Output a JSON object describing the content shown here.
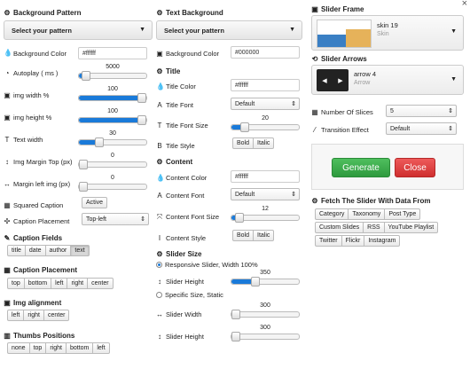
{
  "col1": {
    "bg_pattern": {
      "title": "Background Pattern",
      "select": "Select your pattern"
    },
    "bg_color": {
      "label": "Background Color",
      "value": "#ffffff"
    },
    "autoplay": {
      "label": "Autoplay ( ms )",
      "value": "5000",
      "pct": 0.1
    },
    "img_width": {
      "label": "img width %",
      "value": "100",
      "pct": 1.0
    },
    "img_height": {
      "label": "img height %",
      "value": "100",
      "pct": 1.0
    },
    "text_width": {
      "label": "Text width",
      "value": "30",
      "pct": 0.3
    },
    "img_margin_top": {
      "label": "Img Margin Top (px)",
      "value": "0",
      "pct": 0
    },
    "margin_left": {
      "label": "Margin left img (px)",
      "value": "0",
      "pct": 0
    },
    "squared_caption": {
      "label": "Squared Caption",
      "button": "Active"
    },
    "caption_placement_sel": {
      "label": "Caption Placement",
      "value": "Top-left"
    },
    "caption_fields": {
      "title": "Caption Fields",
      "buttons": [
        "title",
        "date",
        "author",
        "text"
      ]
    },
    "caption_placement": {
      "title": "Caption Placement",
      "buttons": [
        "top",
        "bottom",
        "left",
        "right",
        "center"
      ]
    },
    "img_alignment": {
      "title": "Img alignment",
      "buttons": [
        "left",
        "right",
        "center"
      ]
    },
    "thumbs_positions": {
      "title": "Thumbs Positions",
      "buttons": [
        "none",
        "top",
        "right",
        "bottom",
        "left"
      ]
    }
  },
  "col2": {
    "text_bg": {
      "title": "Text Background",
      "select": "Select your pattern"
    },
    "bg_color": {
      "label": "Background Color",
      "value": "#000000"
    },
    "title_section": "Title",
    "title_color": {
      "label": "Title Color",
      "value": "#ffffff"
    },
    "title_font": {
      "label": "Title Font",
      "value": "Default"
    },
    "title_font_size": {
      "label": "Title Font Size",
      "value": "20",
      "pct": 0.2
    },
    "title_style": {
      "label": "Title Style",
      "buttons": [
        "Bold",
        "Italic"
      ]
    },
    "content_section": "Content",
    "content_color": {
      "label": "Content Color",
      "value": "#ffffff"
    },
    "content_font": {
      "label": "Content Font",
      "value": "Default"
    },
    "content_font_size": {
      "label": "Content Font Size",
      "value": "12",
      "pct": 0.12
    },
    "content_style": {
      "label": "Content Style",
      "buttons": [
        "Bold",
        "Italic"
      ]
    },
    "slider_size": {
      "title": "Slider Size"
    },
    "responsive": {
      "label": "Responsive Slider, Width 100%"
    },
    "slider_height1": {
      "label": "Slider Height",
      "value": "350",
      "pct": 0.35
    },
    "specific": {
      "label": "Specific Size, Static"
    },
    "slider_width": {
      "label": "Slider Width",
      "value": "300",
      "pct": 0
    },
    "slider_height2": {
      "label": "Slider Height",
      "value": "300",
      "pct": 0
    }
  },
  "col3": {
    "close": "×",
    "slider_frame": {
      "title": "Slider Frame",
      "name": "skin 19",
      "sub": "Skin"
    },
    "slider_arrows": {
      "title": "Slider Arrows",
      "name": "arrow 4",
      "sub": "Arrow"
    },
    "slices": {
      "label": "Number Of Slices",
      "value": "5"
    },
    "transition": {
      "label": "Transition Effect",
      "value": "Default"
    },
    "generate": "Generate",
    "close_btn": "Close",
    "fetch": {
      "title": "Fetch The Slider With Data From",
      "row1": [
        "Category",
        "Taxonomy",
        "Post Type"
      ],
      "row2": [
        "Custom Slides",
        "RSS",
        "YouTube Playlist"
      ],
      "row3": [
        "Twitter",
        "Flickr",
        "Instagram"
      ]
    }
  },
  "colors": {
    "accent": "#1a7ad9",
    "generate": "#3aa24a",
    "close": "#dd3b3b"
  }
}
